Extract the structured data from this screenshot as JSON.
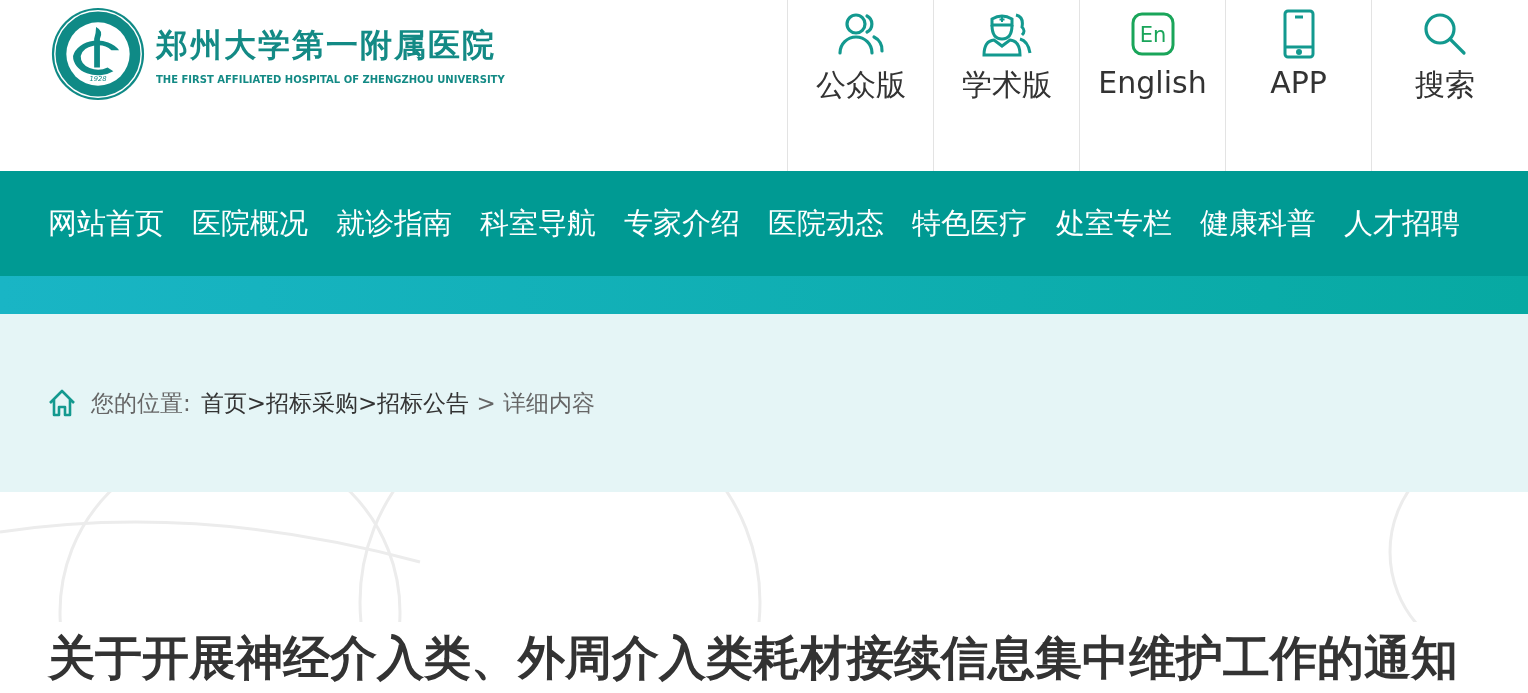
{
  "logo": {
    "year": "1928",
    "name_cn": "郑州大学第一附属医院",
    "name_en": "THE FIRST AFFILIATED HOSPITAL OF ZHENGZHOU UNIVERSITY"
  },
  "quick_links": [
    {
      "kind": "public",
      "label": "公众版"
    },
    {
      "kind": "academic",
      "label": "学术版"
    },
    {
      "kind": "english",
      "label": "English",
      "icon_text": "En"
    },
    {
      "kind": "app",
      "label": "APP"
    },
    {
      "kind": "search",
      "label": "搜索"
    }
  ],
  "nav": [
    {
      "label": "网站首页"
    },
    {
      "label": "医院概况"
    },
    {
      "label": "就诊指南"
    },
    {
      "label": "科室导航"
    },
    {
      "label": "专家介绍"
    },
    {
      "label": "医院动态"
    },
    {
      "label": "特色医疗"
    },
    {
      "label": "处室专栏"
    },
    {
      "label": "健康科普"
    },
    {
      "label": "人才招聘"
    }
  ],
  "breadcrumb": {
    "prefix": "您的位置:",
    "items": [
      {
        "label": "首页",
        "link": true
      },
      {
        "label": ">招标采购",
        "link": true
      },
      {
        "label": ">招标公告",
        "link": true
      },
      {
        "label": " > 详细内容",
        "link": false
      }
    ]
  },
  "article": {
    "title": "关于开展神经介入类、外周介入类耗材接续信息集中维护工作的通知"
  }
}
